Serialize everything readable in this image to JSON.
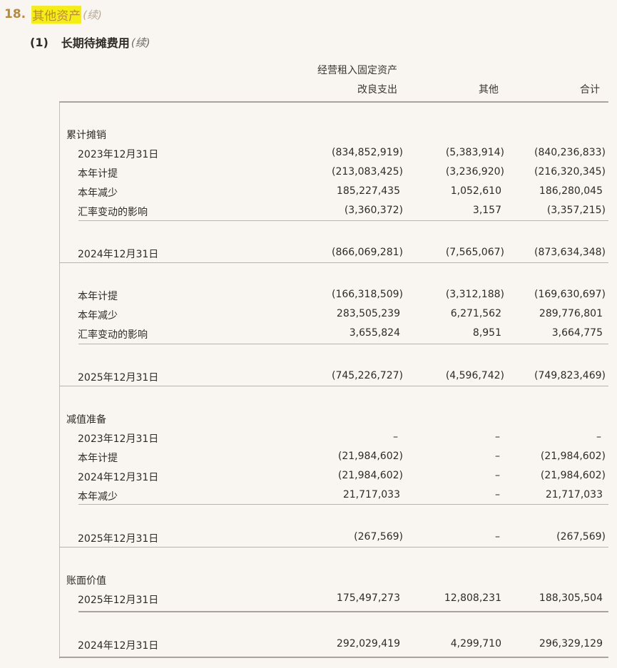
{
  "section": {
    "number": "18.",
    "title": "其他资产",
    "cont": "(续)"
  },
  "subsection": {
    "number": "(1)",
    "title": "长期待摊费用",
    "cont": "(续)"
  },
  "columns": {
    "col1_line1": "经营租入固定资产",
    "col1_line2": "改良支出",
    "col2": "其他",
    "col3": "合计"
  },
  "rows": [
    {
      "label": "累计摊销",
      "c1": "",
      "c2": "",
      "c3": ""
    },
    {
      "label": "2023年12月31日",
      "c1": "(834,852,919)",
      "c2": "(5,383,914)",
      "c3": "(840,236,833)"
    },
    {
      "label": "本年计提",
      "c1": "(213,083,425)",
      "c2": "(3,236,920)",
      "c3": "(216,320,345)"
    },
    {
      "label": "本年减少",
      "c1": "185,227,435",
      "c2": "1,052,610",
      "c3": "186,280,045"
    },
    {
      "label": "汇率变动的影响",
      "c1": "(3,360,372)",
      "c2": "3,157",
      "c3": "(3,357,215)"
    },
    {
      "label": "2024年12月31日",
      "c1": "(866,069,281)",
      "c2": "(7,565,067)",
      "c3": "(873,634,348)"
    },
    {
      "label": "本年计提",
      "c1": "(166,318,509)",
      "c2": "(3,312,188)",
      "c3": "(169,630,697)"
    },
    {
      "label": "本年减少",
      "c1": "283,505,239",
      "c2": "6,271,562",
      "c3": "289,776,801"
    },
    {
      "label": "汇率变动的影响",
      "c1": "3,655,824",
      "c2": "8,951",
      "c3": "3,664,775"
    },
    {
      "label": "2025年12月31日",
      "c1": "(745,226,727)",
      "c2": "(4,596,742)",
      "c3": "(749,823,469)"
    },
    {
      "label": "减值准备",
      "c1": "",
      "c2": "",
      "c3": ""
    },
    {
      "label": "2023年12月31日",
      "c1": "–",
      "c2": "–",
      "c3": "–"
    },
    {
      "label": "本年计提",
      "c1": "(21,984,602)",
      "c2": "–",
      "c3": "(21,984,602)"
    },
    {
      "label": "2024年12月31日",
      "c1": "(21,984,602)",
      "c2": "–",
      "c3": "(21,984,602)"
    },
    {
      "label": "本年减少",
      "c1": "21,717,033",
      "c2": "–",
      "c3": "21,717,033"
    },
    {
      "label": "2025年12月31日",
      "c1": "(267,569)",
      "c2": "–",
      "c3": "(267,569)"
    },
    {
      "label": "账面价值",
      "c1": "",
      "c2": "",
      "c3": ""
    },
    {
      "label": "2025年12月31日",
      "c1": "175,497,273",
      "c2": "12,808,231",
      "c3": "188,305,504"
    },
    {
      "label": "2024年12月31日",
      "c1": "292,029,419",
      "c2": "4,299,710",
      "c3": "296,329,129"
    }
  ]
}
